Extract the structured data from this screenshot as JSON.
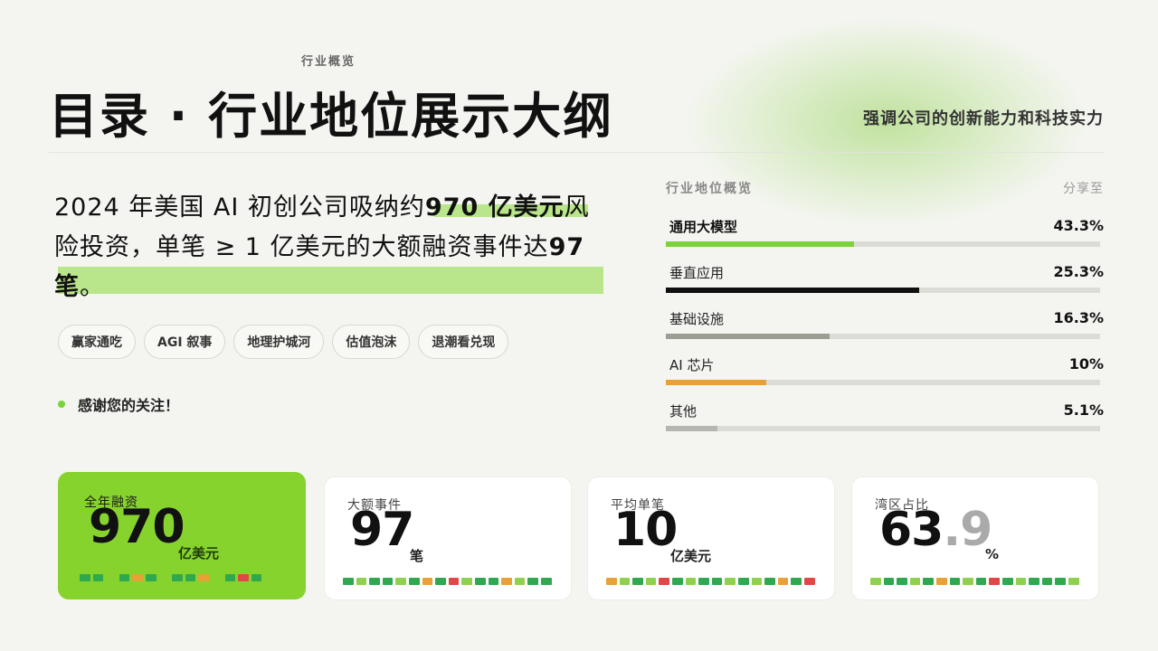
{
  "header": {
    "kicker": "行业概览",
    "title": "目录 · 行业地位展示大纲",
    "subtitle": "强调公司的创新能力和科技实力"
  },
  "lead": {
    "line1_pre": "2024 年美国 AI 初创公司吸纳约",
    "line1_em": "970 亿美元",
    "line1_post": "风",
    "line2_pre": "险投资，单笔 ≥ 1 亿美元的大额融资事件达",
    "line2_em": "97",
    "line3_em": "笔",
    "line3_post": "。"
  },
  "tags": [
    "赢家通吃",
    "AGI 叙事",
    "地理护城河",
    "估值泡沫",
    "退潮看兑现"
  ],
  "note": "感谢您的关注！",
  "panel": {
    "heading": "行业地位概览",
    "share": "分享至",
    "rows": [
      {
        "label": "通用大模型",
        "value": "43.3%",
        "pct": 0.433,
        "color": "#7bd23a"
      },
      {
        "label": "垂直应用",
        "value": "25.3%",
        "pct": 0.583,
        "color": "#111111"
      },
      {
        "label": "基础设施",
        "value": "16.3%",
        "pct": 0.377,
        "color": "#9c9e94"
      },
      {
        "label": "AI 芯片",
        "value": "10%",
        "pct": 0.231,
        "color": "#e8a136"
      },
      {
        "label": "其他",
        "value": "5.1%",
        "pct": 0.118,
        "color": "#b5b6b0"
      }
    ]
  },
  "cards": [
    {
      "label": "全年融资",
      "number": "970",
      "fraction": "",
      "unit": "亿美元"
    },
    {
      "label": "大额事件",
      "number": "97",
      "fraction": "",
      "unit": "笔"
    },
    {
      "label": "平均单笔",
      "number": "10",
      "fraction": "",
      "unit": "亿美元"
    },
    {
      "label": "湾区占比",
      "number": "63",
      "fraction": ".9",
      "unit": "%"
    }
  ],
  "colors": {
    "accent": "#86d32d",
    "highlight": "#b9e68a",
    "background": "#f4f5f1"
  }
}
